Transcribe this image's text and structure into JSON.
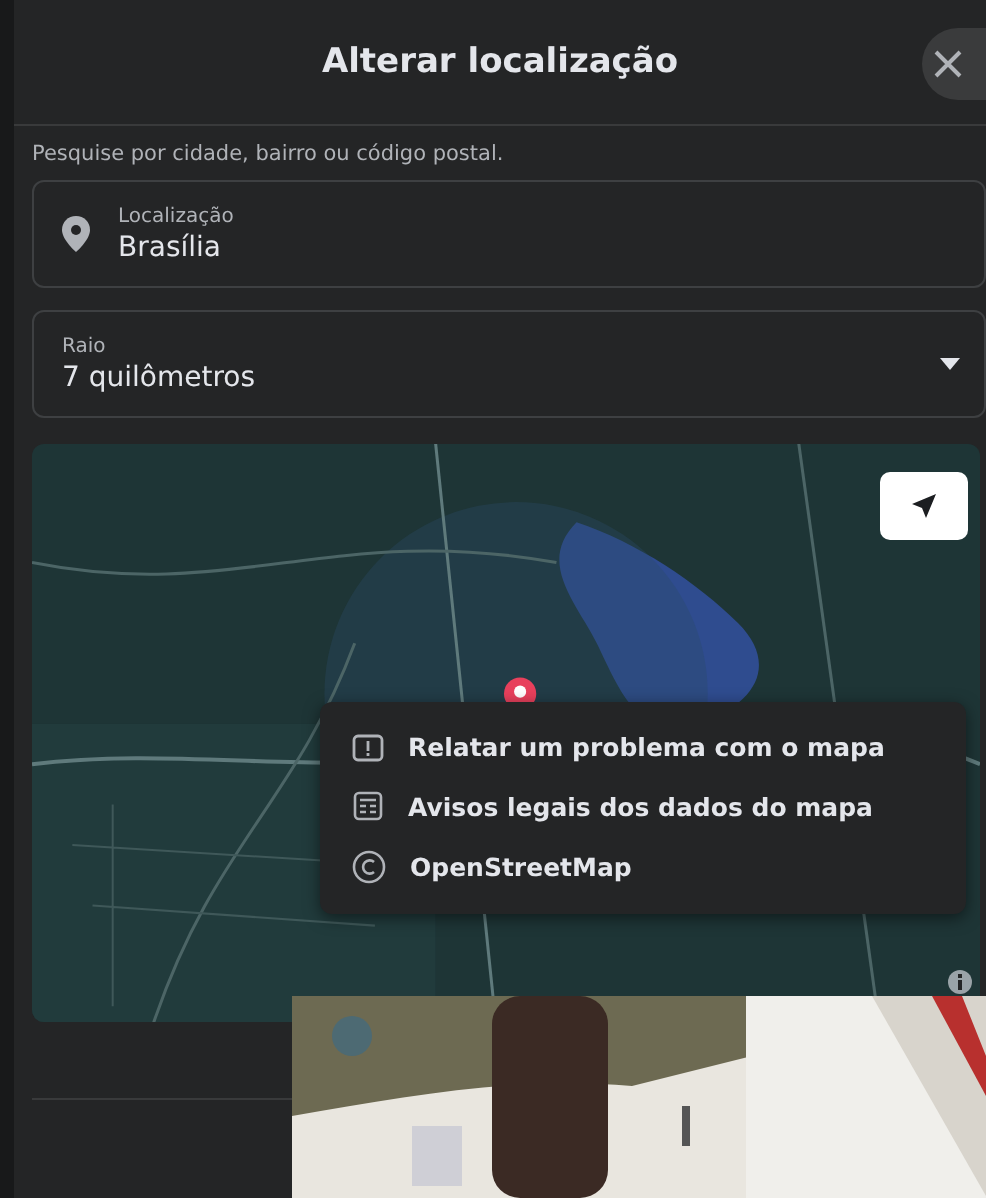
{
  "dialog": {
    "title": "Alterar localização"
  },
  "hint": "Pesquise por cidade, bairro ou código postal.",
  "location_field": {
    "label": "Localização",
    "value": "Brasília"
  },
  "radius_field": {
    "label": "Raio",
    "value": "7 quilômetros"
  },
  "map": {
    "kind": "picture",
    "menu": [
      {
        "kind": "report",
        "label": "Relatar um problema com o mapa"
      },
      {
        "kind": "legal",
        "label": "Avisos legais dos dados do mapa"
      },
      {
        "kind": "copyright",
        "label": "OpenStreetMap"
      }
    ]
  }
}
